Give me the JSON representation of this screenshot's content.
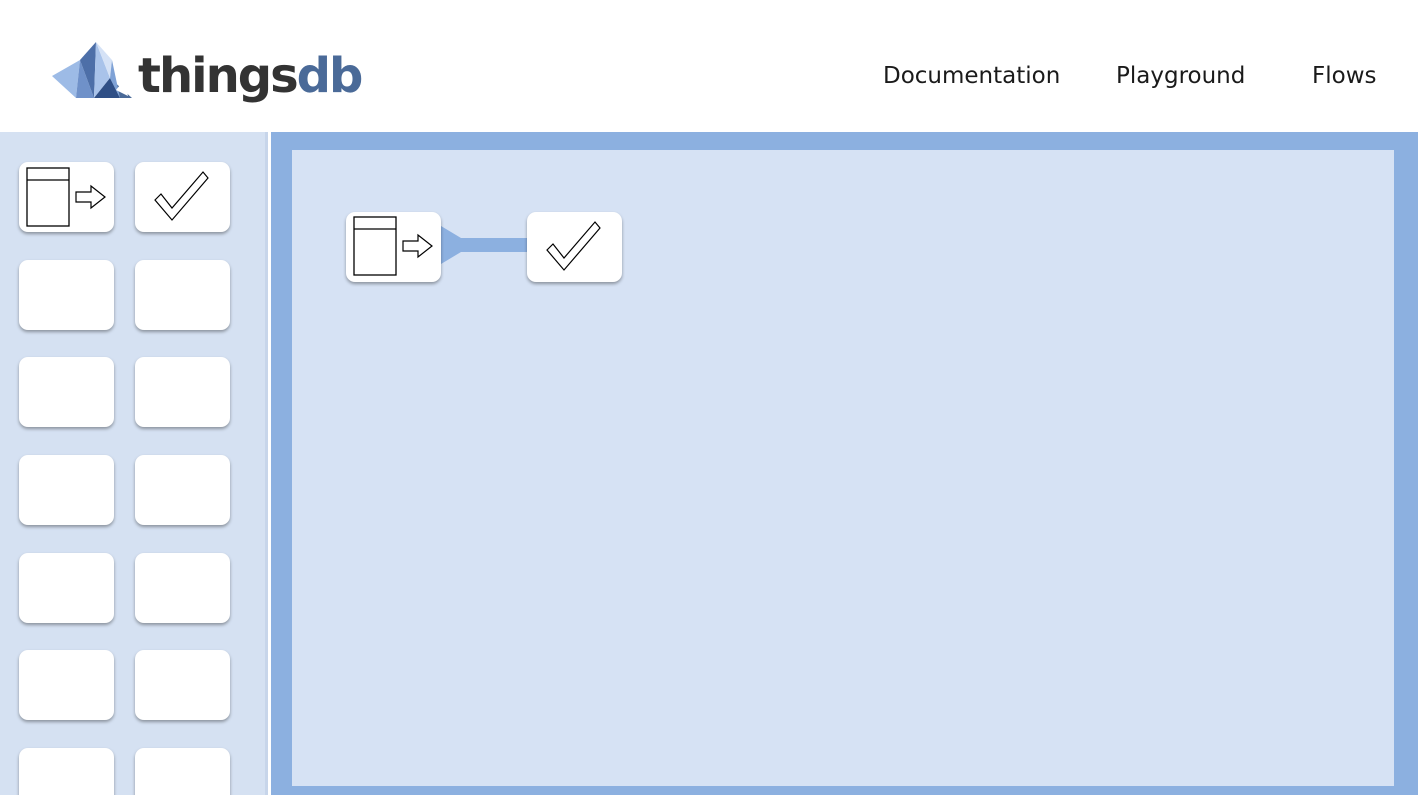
{
  "header": {
    "logo": {
      "text_main": "things",
      "text_accent": "db"
    },
    "nav": [
      {
        "id": "documentation",
        "label": "Documentation"
      },
      {
        "id": "playground",
        "label": "Playground"
      },
      {
        "id": "flows",
        "label": "Flows"
      }
    ]
  },
  "colors": {
    "accent": "#8cb0e0",
    "canvas_bg": "#d6e2f4",
    "sidebar_bg": "#d5e1f2",
    "logo_dark": "#333333",
    "logo_accent": "#4a6a98"
  },
  "palette": {
    "tiles": [
      {
        "icon": "entry-arrow-icon"
      },
      {
        "icon": "checkmark-icon"
      },
      {
        "icon": ""
      },
      {
        "icon": ""
      },
      {
        "icon": ""
      },
      {
        "icon": ""
      },
      {
        "icon": ""
      },
      {
        "icon": ""
      },
      {
        "icon": ""
      },
      {
        "icon": ""
      },
      {
        "icon": ""
      },
      {
        "icon": ""
      },
      {
        "icon": ""
      },
      {
        "icon": ""
      }
    ]
  },
  "flow": {
    "nodes": [
      {
        "id": "start-node",
        "icon": "entry-arrow-icon"
      },
      {
        "id": "end-node",
        "icon": "checkmark-icon"
      }
    ],
    "edges": [
      {
        "from": "start-node",
        "to": "end-node"
      }
    ]
  }
}
